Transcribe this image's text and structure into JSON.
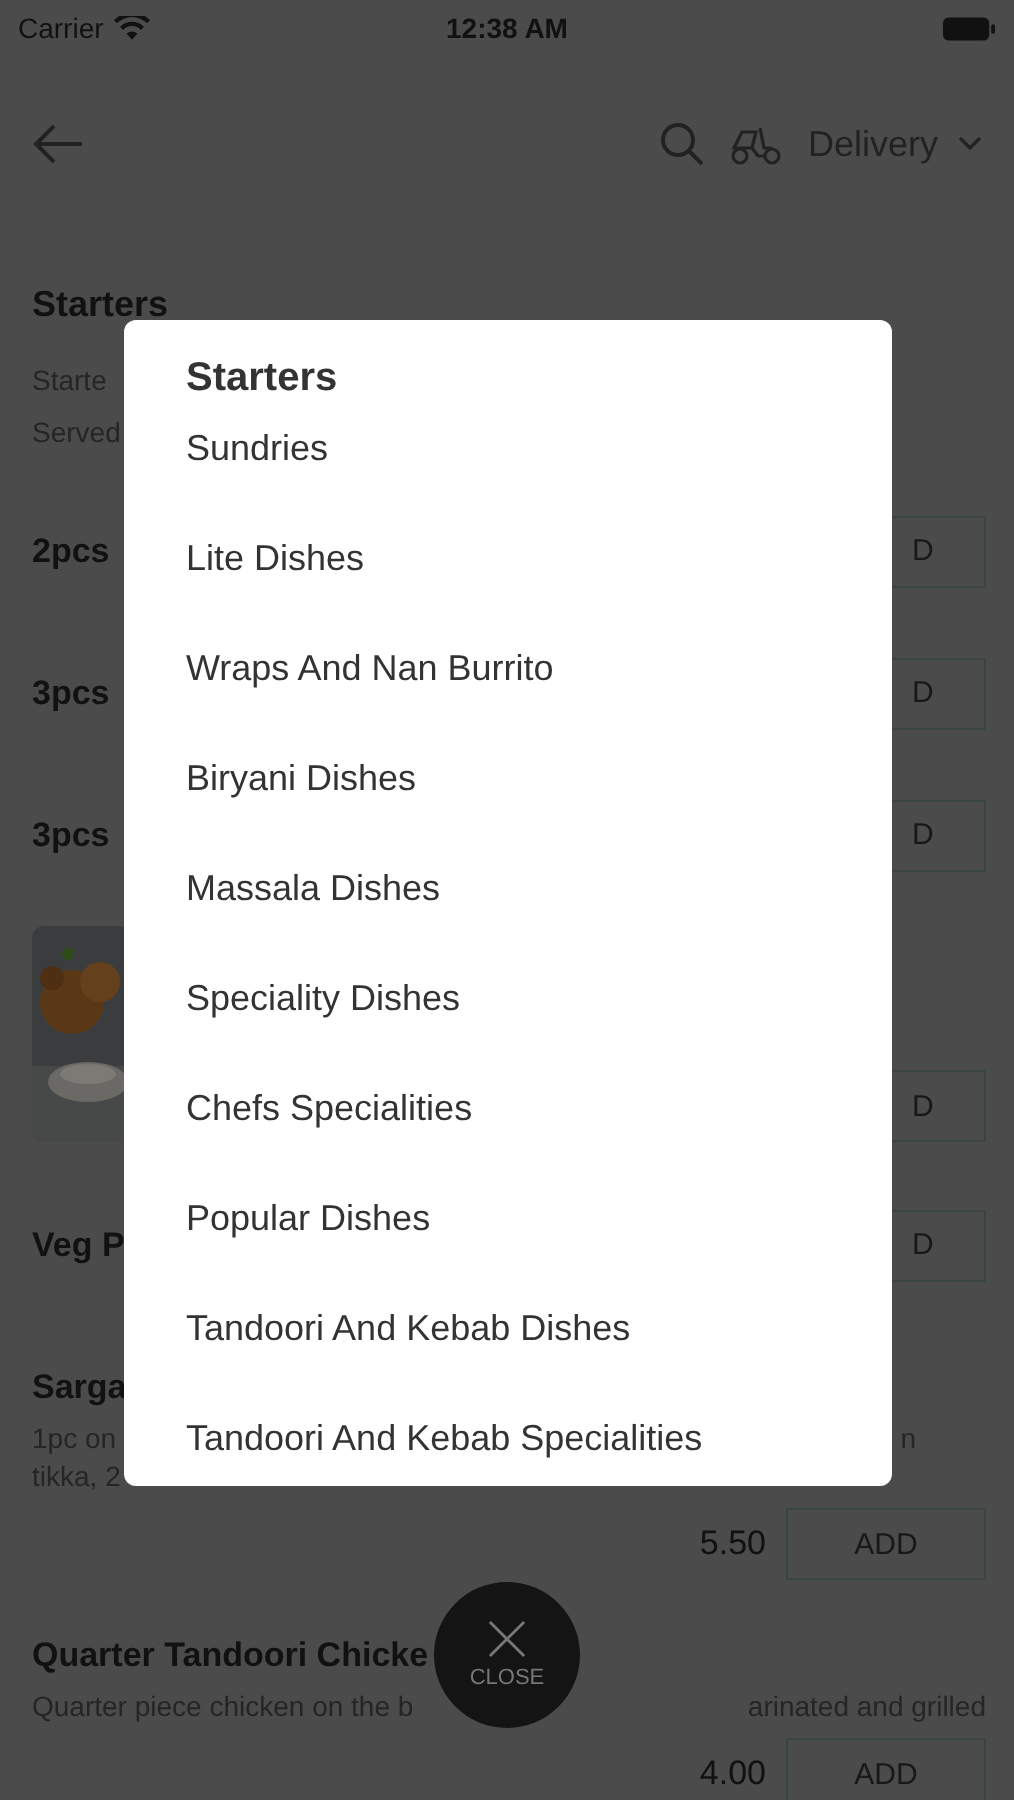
{
  "status_bar": {
    "carrier": "Carrier",
    "time": "12:38 AM"
  },
  "header": {
    "mode": "Delivery"
  },
  "menu": {
    "title": "Starters",
    "description": [
      "Starte",
      "Served"
    ],
    "items": [
      {
        "kind": "row",
        "name": "2pcs",
        "add": "D"
      },
      {
        "kind": "row",
        "name": "3pcs",
        "add": "D"
      },
      {
        "kind": "row",
        "name": "3pcs",
        "add": "D"
      },
      {
        "add": "D"
      },
      {
        "kind": "row",
        "name": "Veg P",
        "add": "D"
      },
      {
        "kind": "detailed",
        "name": "Sarga",
        "description": [
          "1pc on",
          "tikka, 2"
        ],
        "description_right": "n",
        "price": "5.50",
        "add": "ADD"
      },
      {
        "kind": "covered",
        "name": "Quarter Tandoori Chicke",
        "description": [
          "Quarter piece chicken on the b",
          "arinated and grilled"
        ],
        "price": "4.00",
        "add": "ADD"
      }
    ]
  },
  "category_dialog": {
    "title": "Starters",
    "categories": [
      "Sundries",
      "Lite Dishes",
      "Wraps And Nan Burrito",
      "Biryani Dishes",
      "Massala Dishes",
      "Speciality Dishes",
      "Chefs Specialities",
      "Popular Dishes",
      "Tandoori And Kebab Dishes",
      "Tandoori And Kebab Specialities"
    ]
  },
  "close_button": {
    "label": "CLOSE"
  }
}
